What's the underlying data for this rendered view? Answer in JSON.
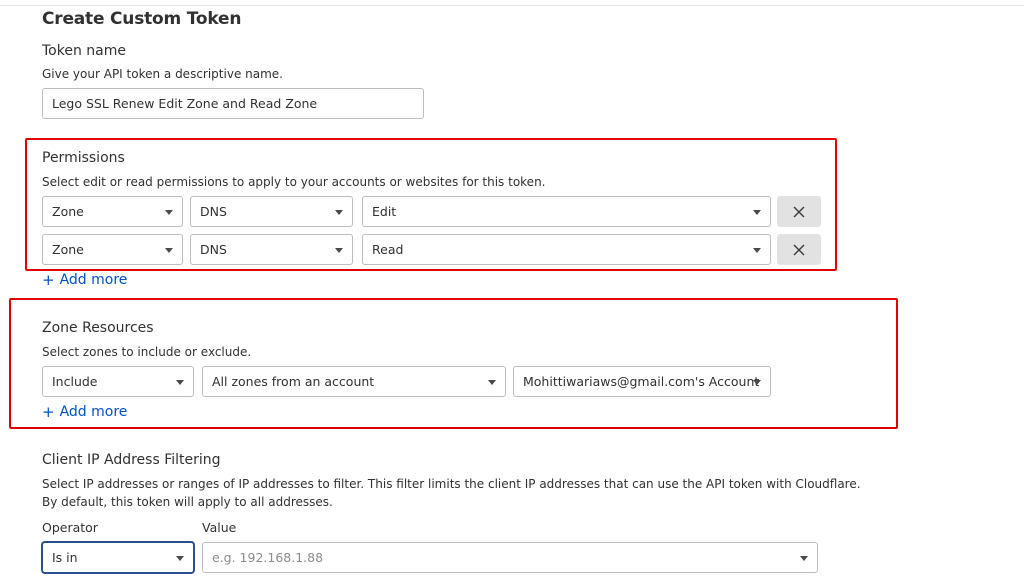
{
  "page": {
    "title": "Create Custom Token"
  },
  "token_name": {
    "label": "Token name",
    "description": "Give your API token a descriptive name.",
    "value": "Lego SSL Renew Edit Zone and Read Zone"
  },
  "permissions": {
    "label": "Permissions",
    "description": "Select edit or read permissions to apply to your accounts or websites for this token.",
    "rows": [
      {
        "scope": "Zone",
        "resource": "DNS",
        "access": "Edit"
      },
      {
        "scope": "Zone",
        "resource": "DNS",
        "access": "Read"
      }
    ],
    "add_more": "Add more"
  },
  "zone_resources": {
    "label": "Zone Resources",
    "description": "Select zones to include or exclude.",
    "include": "Include",
    "zones": "All zones from an account",
    "account": "Mohittiwariaws@gmail.com's Account",
    "add_more": "Add more"
  },
  "ip_filtering": {
    "label": "Client IP Address Filtering",
    "description_line1": "Select IP addresses or ranges of IP addresses to filter. This filter limits the client IP addresses that can use the API token with Cloudflare.",
    "description_line2": "By default, this token will apply to all addresses.",
    "operator_label": "Operator",
    "operator_value": "Is in",
    "value_label": "Value",
    "value_placeholder": "e.g. 192.168.1.88"
  },
  "colors": {
    "link": "#0051c3",
    "highlight": "#e00000",
    "focus": "#2c4f8c"
  }
}
